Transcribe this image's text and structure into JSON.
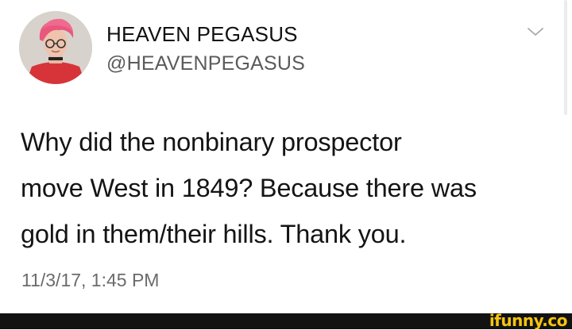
{
  "tweet": {
    "display_name": "HEAVEN PEGASUS",
    "handle": "@HEAVENPEGASUS",
    "text_lines": [
      "Why did the nonbinary prospector",
      "move West in 1849? Because there was",
      "gold in them/their hills. Thank you."
    ],
    "timestamp": "11/3/17, 1:45 PM",
    "avatar_icon": "profile-photo",
    "menu_icon": "chevron-down-icon"
  },
  "watermark": {
    "text": "ifunny.co",
    "color": "#f6c40e"
  },
  "colors": {
    "background": "#ffffff",
    "text": "#141414",
    "secondary_text": "#5b5b5b",
    "footer_bar": "#121212"
  }
}
